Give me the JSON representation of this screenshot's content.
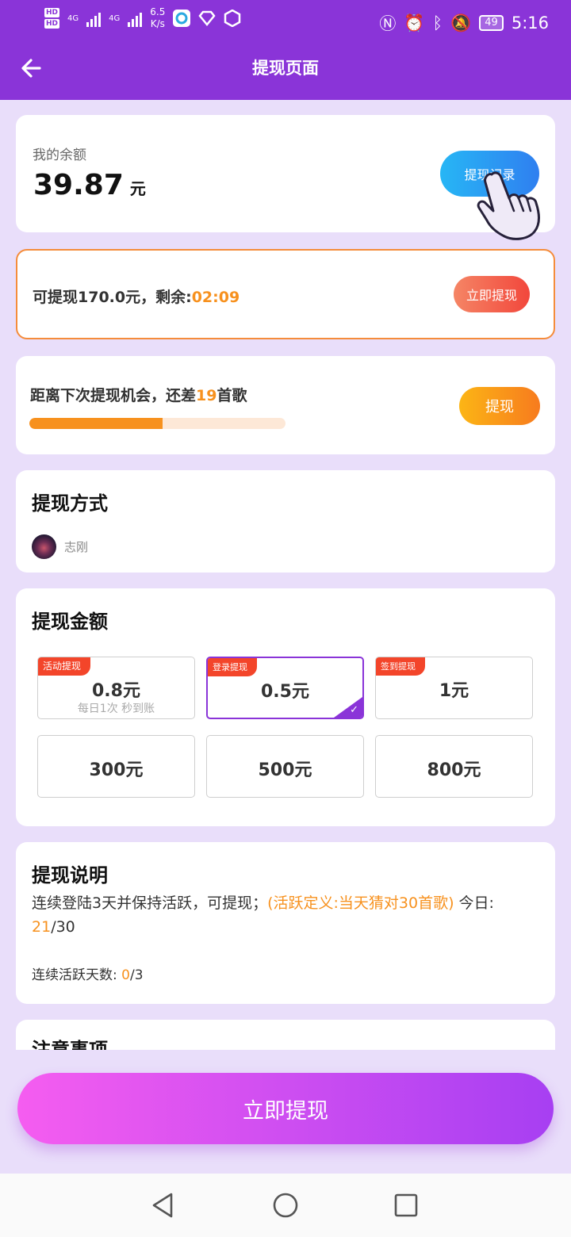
{
  "status_bar": {
    "network_badge_1": "HD",
    "network_badge_2": "HD",
    "signal_1": "4G",
    "signal_2": "4G",
    "speed": "6.5",
    "speed_unit": "K/s",
    "battery": "49",
    "time": "5:16"
  },
  "header": {
    "title": "提现页面"
  },
  "balance": {
    "label": "我的余额",
    "amount": "39.87",
    "unit": "元",
    "history_button": "提现记录"
  },
  "timer_offer": {
    "text": "可提现170.0元，剩余:",
    "countdown": "02:09",
    "button": "立即提现"
  },
  "next_chance": {
    "text_prefix": "距离下次提现机会，还差",
    "songs_needed": "19",
    "text_suffix": "首歌",
    "progress_fraction": 0.52,
    "button": "提现"
  },
  "method": {
    "title": "提现方式",
    "account_name": "志刚"
  },
  "amount": {
    "title": "提现金额",
    "options": [
      {
        "label": "0.8元",
        "tag": "活动提现",
        "sub": "每日1次 秒到账",
        "selected": false
      },
      {
        "label": "0.5元",
        "tag": "登录提现",
        "sub": "",
        "selected": true
      },
      {
        "label": "1元",
        "tag": "签到提现",
        "sub": "",
        "selected": false
      },
      {
        "label": "300元",
        "tag": "",
        "sub": "",
        "selected": false
      },
      {
        "label": "500元",
        "tag": "",
        "sub": "",
        "selected": false
      },
      {
        "label": "800元",
        "tag": "",
        "sub": "",
        "selected": false
      }
    ]
  },
  "description": {
    "title": "提现说明",
    "line1_prefix": "连续登陆3天并保持活跃，可提现；",
    "line1_highlight": "(活跃定义:当天猜对30首歌)",
    "line1_today": "今日:",
    "today_done": "21",
    "today_total": "/30",
    "line2_prefix": "连续活跃天数:",
    "days_done": "0",
    "days_total": "/3"
  },
  "notes": {
    "title": "注意事项"
  },
  "cta": {
    "label": "立即提现"
  },
  "colors": {
    "brand_purple": "#8a34d8",
    "accent_orange": "#f7911e",
    "tag_red": "#f3452a"
  },
  "icons": {
    "back": "arrow-left-icon",
    "pointer": "hand-pointer-icon",
    "nav_back": "triangle-back-icon",
    "nav_home": "circle-home-icon",
    "nav_recent": "square-recent-icon"
  }
}
